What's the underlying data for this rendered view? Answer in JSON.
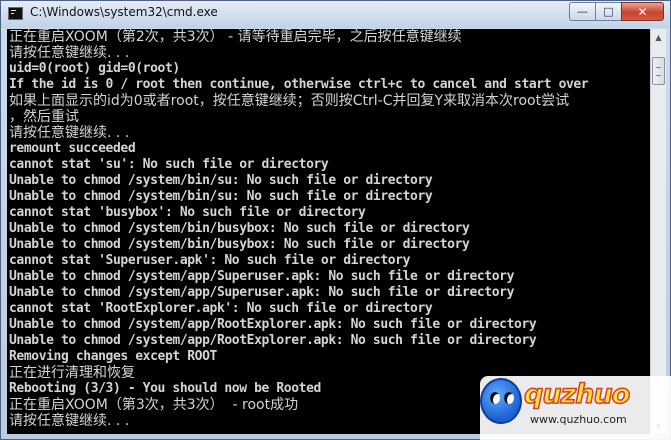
{
  "window": {
    "title": "C:\\Windows\\system32\\cmd.exe",
    "minimize_glyph": "—",
    "maximize_glyph": "□",
    "close_glyph": "✕"
  },
  "console": {
    "lines": [
      "正在重启XOOM（第2次，共3次） - 请等待重启完毕，之后按任意键继续",
      "请按任意键继续. . .",
      "uid=0(root) gid=0(root)",
      "If the id is 0 / root then continue, otherwise ctrl+c to cancel and start over",
      "如果上面显示的id为0或者root，按任意键继续；否则按Ctrl-C并回复Y来取消本次root尝试",
      "，然后重试",
      "请按任意键继续. . .",
      "remount succeeded",
      "cannot stat 'su': No such file or directory",
      "Unable to chmod /system/bin/su: No such file or directory",
      "Unable to chmod /system/bin/su: No such file or directory",
      "cannot stat 'busybox': No such file or directory",
      "Unable to chmod /system/bin/busybox: No such file or directory",
      "Unable to chmod /system/bin/busybox: No such file or directory",
      "cannot stat 'Superuser.apk': No such file or directory",
      "Unable to chmod /system/app/Superuser.apk: No such file or directory",
      "Unable to chmod /system/app/Superuser.apk: No such file or directory",
      "cannot stat 'RootExplorer.apk': No such file or directory",
      "Unable to chmod /system/app/RootExplorer.apk: No such file or directory",
      "Unable to chmod /system/app/RootExplorer.apk: No such file or directory",
      "Removing changes except ROOT",
      "正在进行清理和恢复",
      "Rebooting (3/3) - You should now be Rooted",
      "正在重启XOOM（第3次，共3次）  - root成功",
      "请按任意键继续. . ."
    ]
  },
  "scrollbar": {
    "up_glyph": "▲",
    "down_glyph": "▼"
  },
  "watermark": {
    "logo": "quzhuo",
    "url": "www.quzhuo.com"
  },
  "colors": {
    "console_bg": "#000000",
    "console_text": "#c0c0c0",
    "close_button": "#c8442d"
  }
}
